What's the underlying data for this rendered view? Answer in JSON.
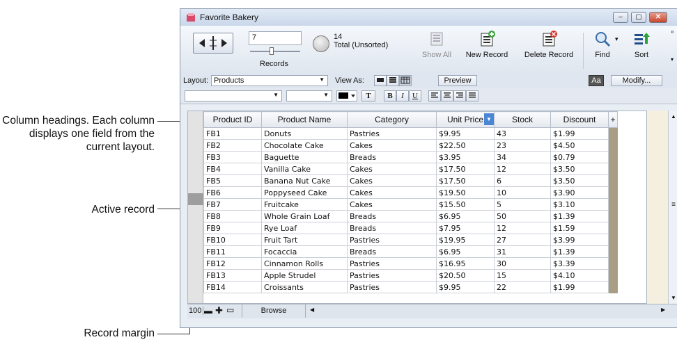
{
  "callouts": {
    "column_headings": "Column headings. Each column displays one field from the current layout.",
    "active_record": "Active record",
    "record_margin": "Record margin"
  },
  "window": {
    "title": "Favorite Bakery",
    "minimize": "–",
    "maximize": "▢",
    "close": "✕"
  },
  "toolbar": {
    "record_number": "7",
    "records_label": "Records",
    "total_count": "14",
    "total_label": "Total (Unsorted)",
    "show_all": "Show All",
    "new_record": "New Record",
    "delete_record": "Delete Record",
    "find": "Find",
    "sort": "Sort"
  },
  "layoutbar": {
    "layout_label": "Layout:",
    "layout_value": "Products",
    "view_as_label": "View As:",
    "preview": "Preview",
    "aa": "Aa",
    "modify": "Modify..."
  },
  "fmtbar": {
    "text_btn": "T",
    "bold": "B",
    "italic": "I",
    "underline": "U"
  },
  "table": {
    "headers": [
      "Product ID",
      "Product Name",
      "Category",
      "Unit Price",
      "Stock",
      "Discount",
      "+"
    ],
    "rows": [
      [
        "FB1",
        "Donuts",
        "Pastries",
        "$9.95",
        "43",
        "$1.99"
      ],
      [
        "FB2",
        "Chocolate Cake",
        "Cakes",
        "$22.50",
        "23",
        "$4.50"
      ],
      [
        "FB3",
        "Baguette",
        "Breads",
        "$3.95",
        "34",
        "$0.79"
      ],
      [
        "FB4",
        "Vanilla Cake",
        "Cakes",
        "$17.50",
        "12",
        "$3.50"
      ],
      [
        "FB5",
        "Banana Nut Cake",
        "Cakes",
        "$17.50",
        "6",
        "$3.50"
      ],
      [
        "FB6",
        "Poppyseed Cake",
        "Cakes",
        "$19.50",
        "10",
        "$3.90"
      ],
      [
        "FB7",
        "Fruitcake",
        "Cakes",
        "$15.50",
        "5",
        "$3.10"
      ],
      [
        "FB8",
        "Whole Grain Loaf",
        "Breads",
        "$6.95",
        "50",
        "$1.39"
      ],
      [
        "FB9",
        "Rye Loaf",
        "Breads",
        "$7.95",
        "12",
        "$1.59"
      ],
      [
        "FB10",
        "Fruit Tart",
        "Pastries",
        "$19.95",
        "27",
        "$3.99"
      ],
      [
        "FB11",
        "Focaccia",
        "Breads",
        "$6.95",
        "31",
        "$1.39"
      ],
      [
        "FB12",
        "Cinnamon Rolls",
        "Pastries",
        "$16.95",
        "30",
        "$3.39"
      ],
      [
        "FB13",
        "Apple Strudel",
        "Pastries",
        "$20.50",
        "15",
        "$4.10"
      ],
      [
        "FB14",
        "Croissants",
        "Pastries",
        "$9.95",
        "22",
        "$1.99"
      ]
    ],
    "active_row": 6
  },
  "statusbar": {
    "zoom": "100",
    "mode": "Browse"
  }
}
